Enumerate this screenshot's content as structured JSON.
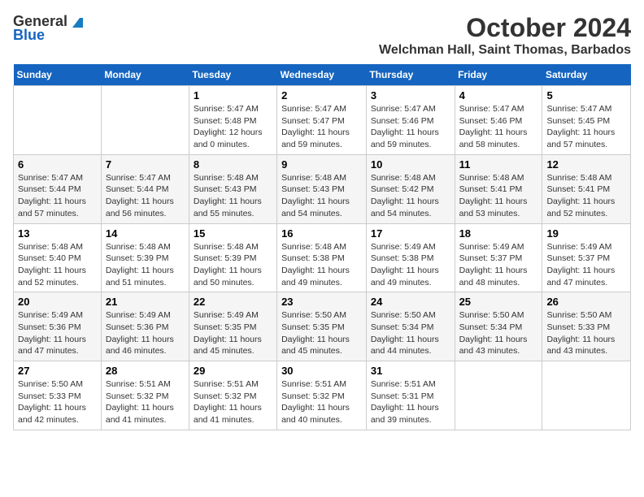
{
  "logo": {
    "general": "General",
    "blue": "Blue"
  },
  "header": {
    "month": "October 2024",
    "location": "Welchman Hall, Saint Thomas, Barbados"
  },
  "weekdays": [
    "Sunday",
    "Monday",
    "Tuesday",
    "Wednesday",
    "Thursday",
    "Friday",
    "Saturday"
  ],
  "weeks": [
    [
      {
        "day": "",
        "sunrise": "",
        "sunset": "",
        "daylight": ""
      },
      {
        "day": "",
        "sunrise": "",
        "sunset": "",
        "daylight": ""
      },
      {
        "day": "1",
        "sunrise": "Sunrise: 5:47 AM",
        "sunset": "Sunset: 5:48 PM",
        "daylight": "Daylight: 12 hours and 0 minutes."
      },
      {
        "day": "2",
        "sunrise": "Sunrise: 5:47 AM",
        "sunset": "Sunset: 5:47 PM",
        "daylight": "Daylight: 11 hours and 59 minutes."
      },
      {
        "day": "3",
        "sunrise": "Sunrise: 5:47 AM",
        "sunset": "Sunset: 5:46 PM",
        "daylight": "Daylight: 11 hours and 59 minutes."
      },
      {
        "day": "4",
        "sunrise": "Sunrise: 5:47 AM",
        "sunset": "Sunset: 5:46 PM",
        "daylight": "Daylight: 11 hours and 58 minutes."
      },
      {
        "day": "5",
        "sunrise": "Sunrise: 5:47 AM",
        "sunset": "Sunset: 5:45 PM",
        "daylight": "Daylight: 11 hours and 57 minutes."
      }
    ],
    [
      {
        "day": "6",
        "sunrise": "Sunrise: 5:47 AM",
        "sunset": "Sunset: 5:44 PM",
        "daylight": "Daylight: 11 hours and 57 minutes."
      },
      {
        "day": "7",
        "sunrise": "Sunrise: 5:47 AM",
        "sunset": "Sunset: 5:44 PM",
        "daylight": "Daylight: 11 hours and 56 minutes."
      },
      {
        "day": "8",
        "sunrise": "Sunrise: 5:48 AM",
        "sunset": "Sunset: 5:43 PM",
        "daylight": "Daylight: 11 hours and 55 minutes."
      },
      {
        "day": "9",
        "sunrise": "Sunrise: 5:48 AM",
        "sunset": "Sunset: 5:43 PM",
        "daylight": "Daylight: 11 hours and 54 minutes."
      },
      {
        "day": "10",
        "sunrise": "Sunrise: 5:48 AM",
        "sunset": "Sunset: 5:42 PM",
        "daylight": "Daylight: 11 hours and 54 minutes."
      },
      {
        "day": "11",
        "sunrise": "Sunrise: 5:48 AM",
        "sunset": "Sunset: 5:41 PM",
        "daylight": "Daylight: 11 hours and 53 minutes."
      },
      {
        "day": "12",
        "sunrise": "Sunrise: 5:48 AM",
        "sunset": "Sunset: 5:41 PM",
        "daylight": "Daylight: 11 hours and 52 minutes."
      }
    ],
    [
      {
        "day": "13",
        "sunrise": "Sunrise: 5:48 AM",
        "sunset": "Sunset: 5:40 PM",
        "daylight": "Daylight: 11 hours and 52 minutes."
      },
      {
        "day": "14",
        "sunrise": "Sunrise: 5:48 AM",
        "sunset": "Sunset: 5:39 PM",
        "daylight": "Daylight: 11 hours and 51 minutes."
      },
      {
        "day": "15",
        "sunrise": "Sunrise: 5:48 AM",
        "sunset": "Sunset: 5:39 PM",
        "daylight": "Daylight: 11 hours and 50 minutes."
      },
      {
        "day": "16",
        "sunrise": "Sunrise: 5:48 AM",
        "sunset": "Sunset: 5:38 PM",
        "daylight": "Daylight: 11 hours and 49 minutes."
      },
      {
        "day": "17",
        "sunrise": "Sunrise: 5:49 AM",
        "sunset": "Sunset: 5:38 PM",
        "daylight": "Daylight: 11 hours and 49 minutes."
      },
      {
        "day": "18",
        "sunrise": "Sunrise: 5:49 AM",
        "sunset": "Sunset: 5:37 PM",
        "daylight": "Daylight: 11 hours and 48 minutes."
      },
      {
        "day": "19",
        "sunrise": "Sunrise: 5:49 AM",
        "sunset": "Sunset: 5:37 PM",
        "daylight": "Daylight: 11 hours and 47 minutes."
      }
    ],
    [
      {
        "day": "20",
        "sunrise": "Sunrise: 5:49 AM",
        "sunset": "Sunset: 5:36 PM",
        "daylight": "Daylight: 11 hours and 47 minutes."
      },
      {
        "day": "21",
        "sunrise": "Sunrise: 5:49 AM",
        "sunset": "Sunset: 5:36 PM",
        "daylight": "Daylight: 11 hours and 46 minutes."
      },
      {
        "day": "22",
        "sunrise": "Sunrise: 5:49 AM",
        "sunset": "Sunset: 5:35 PM",
        "daylight": "Daylight: 11 hours and 45 minutes."
      },
      {
        "day": "23",
        "sunrise": "Sunrise: 5:50 AM",
        "sunset": "Sunset: 5:35 PM",
        "daylight": "Daylight: 11 hours and 45 minutes."
      },
      {
        "day": "24",
        "sunrise": "Sunrise: 5:50 AM",
        "sunset": "Sunset: 5:34 PM",
        "daylight": "Daylight: 11 hours and 44 minutes."
      },
      {
        "day": "25",
        "sunrise": "Sunrise: 5:50 AM",
        "sunset": "Sunset: 5:34 PM",
        "daylight": "Daylight: 11 hours and 43 minutes."
      },
      {
        "day": "26",
        "sunrise": "Sunrise: 5:50 AM",
        "sunset": "Sunset: 5:33 PM",
        "daylight": "Daylight: 11 hours and 43 minutes."
      }
    ],
    [
      {
        "day": "27",
        "sunrise": "Sunrise: 5:50 AM",
        "sunset": "Sunset: 5:33 PM",
        "daylight": "Daylight: 11 hours and 42 minutes."
      },
      {
        "day": "28",
        "sunrise": "Sunrise: 5:51 AM",
        "sunset": "Sunset: 5:32 PM",
        "daylight": "Daylight: 11 hours and 41 minutes."
      },
      {
        "day": "29",
        "sunrise": "Sunrise: 5:51 AM",
        "sunset": "Sunset: 5:32 PM",
        "daylight": "Daylight: 11 hours and 41 minutes."
      },
      {
        "day": "30",
        "sunrise": "Sunrise: 5:51 AM",
        "sunset": "Sunset: 5:32 PM",
        "daylight": "Daylight: 11 hours and 40 minutes."
      },
      {
        "day": "31",
        "sunrise": "Sunrise: 5:51 AM",
        "sunset": "Sunset: 5:31 PM",
        "daylight": "Daylight: 11 hours and 39 minutes."
      },
      {
        "day": "",
        "sunrise": "",
        "sunset": "",
        "daylight": ""
      },
      {
        "day": "",
        "sunrise": "",
        "sunset": "",
        "daylight": ""
      }
    ]
  ]
}
